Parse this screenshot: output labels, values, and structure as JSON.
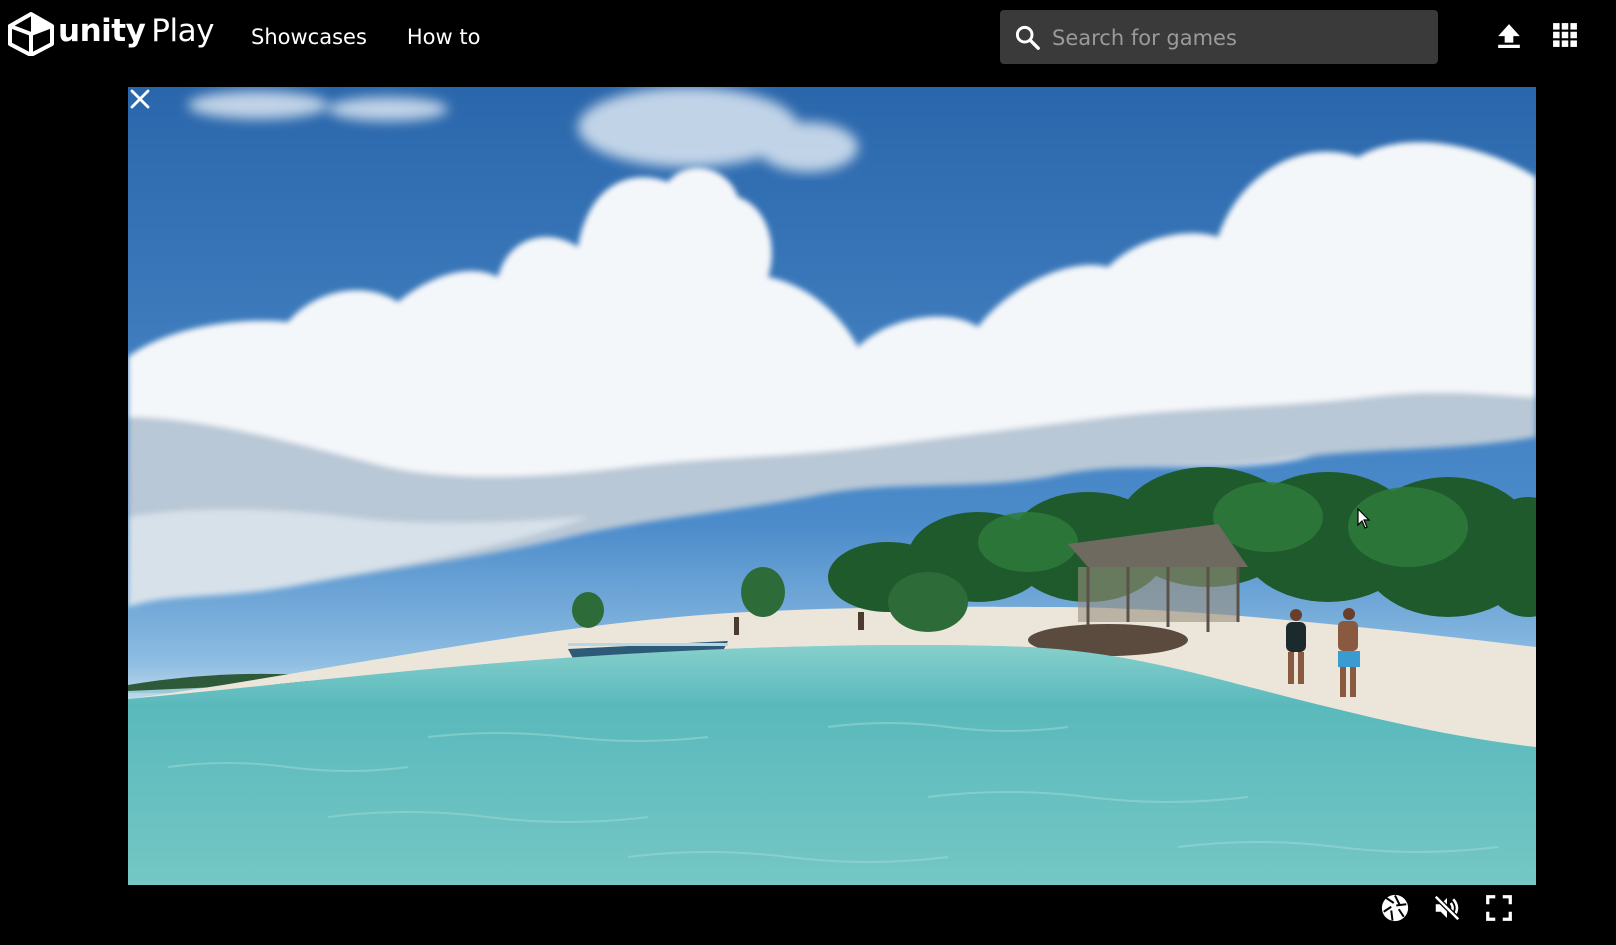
{
  "header": {
    "logo_text": "unity",
    "logo_text_suffix": "Play",
    "nav": [
      {
        "label": "Showcases"
      },
      {
        "label": "How to"
      }
    ],
    "search": {
      "placeholder": "Search for games",
      "value": ""
    },
    "icons": {
      "search": "search-icon",
      "upload": "upload-icon",
      "apps": "apps-grid-icon"
    }
  },
  "game": {
    "scene": "tropical beach with hut, people, boat and turquoise water under a cloudy sky",
    "close_icon": "close-icon"
  },
  "controls": {
    "icons": [
      "screenshot-aperture-icon",
      "mute-icon",
      "fullscreen-icon"
    ]
  },
  "colors": {
    "background": "#000000",
    "search_bg": "#3a3a3a",
    "placeholder": "#9a9a9a",
    "sky": "#3d7dc0",
    "water": "#5fbcbe",
    "sand": "#e8e3d6"
  }
}
